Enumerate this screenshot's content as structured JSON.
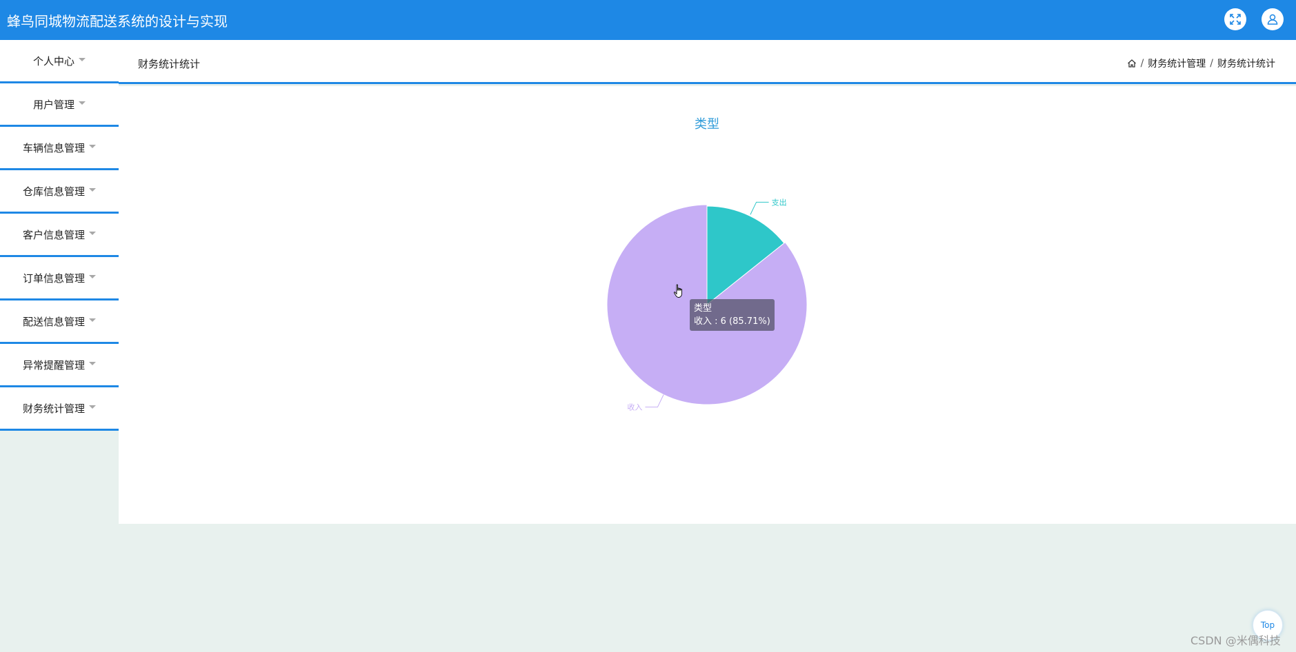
{
  "header": {
    "title": "蜂鸟同城物流配送系统的设计与实现"
  },
  "sidebar": {
    "items": [
      {
        "label": "个人中心"
      },
      {
        "label": "用户管理"
      },
      {
        "label": "车辆信息管理"
      },
      {
        "label": "仓库信息管理"
      },
      {
        "label": "客户信息管理"
      },
      {
        "label": "订单信息管理"
      },
      {
        "label": "配送信息管理"
      },
      {
        "label": "异常提醒管理"
      },
      {
        "label": "财务统计管理"
      }
    ]
  },
  "page": {
    "title": "财务统计统计"
  },
  "breadcrumb": {
    "level1": "财务统计管理",
    "level2": "财务统计统计",
    "separator": "/"
  },
  "tooltip": {
    "title": "类型",
    "line": "收入 : 6 (85.71%)"
  },
  "scroll_top": {
    "label": "Top"
  },
  "watermark": {
    "text": "CSDN @米偶科技"
  },
  "colors": {
    "accent": "#1e88e5",
    "income": "#c6aef5",
    "expense": "#2ec7c9",
    "chart_title": "#2f9bd9"
  },
  "chart_data": {
    "type": "pie",
    "title": "类型",
    "slices": [
      {
        "name": "支出",
        "value": 1,
        "color": "#2ec7c9"
      },
      {
        "name": "收入",
        "value": 6,
        "color": "#c6aef5"
      }
    ],
    "highlighted": "收入",
    "highlighted_percent": 85.71
  }
}
